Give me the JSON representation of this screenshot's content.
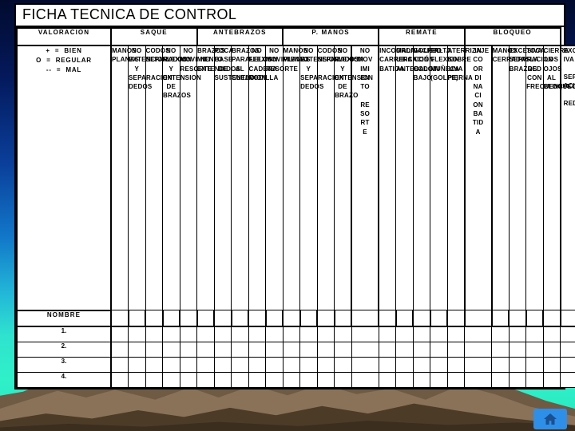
{
  "document": {
    "title": "FICHA TECNICA DE CONTROL"
  },
  "legend": {
    "header": "VALORACION",
    "lines": [
      "+  =  BIEN",
      "O  =  REGULAR",
      "--  =  MAL"
    ]
  },
  "name_header": "NOMBRE",
  "groups": [
    {
      "label": "SAQUE",
      "span": 5
    },
    {
      "label": "ANTEBRAZOS",
      "span": 5
    },
    {
      "label": "P. MANOS",
      "span": 5
    },
    {
      "label": "REMATE",
      "span": 5
    },
    {
      "label": "BLOQUEO",
      "span": 5
    },
    {
      "label": "",
      "span": 1
    }
  ],
  "columns": [
    {
      "group": "SAQUE",
      "text": "MANOS\nPLANAS"
    },
    {
      "group": "SAQUE",
      "text": "NO\nEXTENCION\nY\nSEPARACION\nDEDOS"
    },
    {
      "group": "SAQUE",
      "text": "CODOS\nSEPARADOS"
    },
    {
      "group": "SAQUE",
      "text": "NO\nFLEXION\nY\nEXTENSION\nDE\nBRAZOS"
    },
    {
      "group": "SAQUE",
      "text": "NO\nMOVIMIENTO\nRESORTE"
    },
    {
      "group": "ANTEBRAZOS",
      "text": "BRAZOS\nNO\nEXTENDIDOS"
    },
    {
      "group": "ANTEBRAZOS",
      "text": "POCA\nBASE\nDE\nSUSTENTACION"
    },
    {
      "group": "ANTEBRAZOS",
      "text": "BRAZOS\nPARALELOS\nAL\nSUELO"
    },
    {
      "group": "ANTEBRAZOS",
      "text": "NO\nFLEXION\nCADERA\nRODILLA"
    },
    {
      "group": "ANTEBRAZOS",
      "text": "NO\nMOVIMIENTO\nRESORTE"
    },
    {
      "group": "P. MANOS",
      "text": "MANOS\nPLANAS"
    },
    {
      "group": "P. MANOS",
      "text": "NO\nEXTENSION\nY\nSEPARACION\nDEDOS"
    },
    {
      "group": "P. MANOS",
      "text": "CODOS\nSEPARADOS"
    },
    {
      "group": "P. MANOS",
      "text": "NO\nFLEXION\nY\nEXTENSION\nDE\nBRAZO"
    },
    {
      "group": "P. MANOS",
      "text": "NO\nMOV\nIMI\nEN\nTO\n\nRE\nSO\nRT\nE",
      "wide": true
    },
    {
      "group": "REMATE",
      "text": "INCOORDINACION\nCARRERA\nBATIDA"
    },
    {
      "group": "REMATE",
      "text": "MALA\nUBICACIÓN\nANTEBALOIN"
    },
    {
      "group": "REMATE",
      "text": "GOLPEO\nCON\nCODO\nBAJO"
    },
    {
      "group": "REMATE",
      "text": "FALTA\nFLEXION\nMUÑECA\n(GOLPE)"
    },
    {
      "group": "REMATE",
      "text": "ATERRIZAJE\nSOBRE\nUNA\nPIERNA"
    },
    {
      "group": "BLOQUEO",
      "text": "IN\nCO\nOR\nDI\nNA\nCI\nON\nBA\nTID\nA",
      "wide": true
    },
    {
      "group": "BLOQUEO",
      "text": "MANOS\nCERRADAS"
    },
    {
      "group": "BLOQUEO",
      "text": "EXCESIVA\nSEPARACION\nBRAZOS"
    },
    {
      "group": "BLOQUEO",
      "text": "TOCA\nLA\nRED\nCON\nFRECUENCIA"
    },
    {
      "group": "BLOQUEO",
      "text": "CIERRA\nLOS\nOJOS\nAL\nBLOQUEO"
    },
    {
      "group": "",
      "text": "EXCES\nIVA\n\nSEPAR\nACION\n\nRED",
      "wide": true,
      "horizontal": true
    }
  ],
  "rows": [
    {
      "label": "1."
    },
    {
      "label": "2."
    },
    {
      "label": "3."
    },
    {
      "label": "4."
    }
  ],
  "home_button": {
    "icon": "home-icon",
    "color": "#2d8fe8"
  },
  "colors": {
    "sheet_background": "#ffffff",
    "border": "#000000",
    "sky_top": "#020b2e",
    "sky_bottom": "#2ff0c8",
    "mountain": "#6f5a44"
  }
}
